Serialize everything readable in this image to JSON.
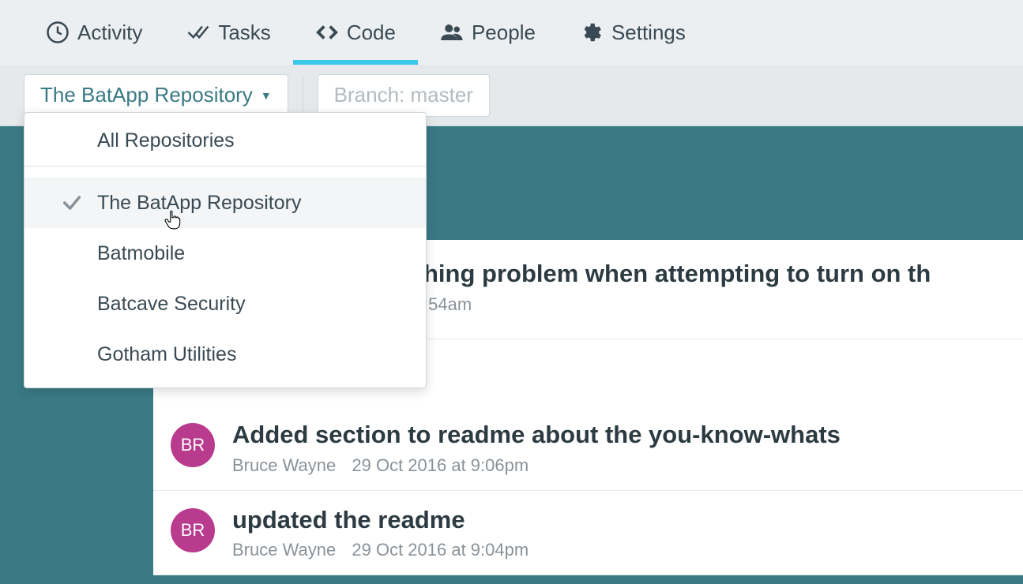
{
  "nav": {
    "activity": "Activity",
    "tasks": "Tasks",
    "code": "Code",
    "people": "People",
    "settings": "Settings"
  },
  "filters": {
    "repo_label": "The BatApp Repository",
    "branch_label": "Branch: master"
  },
  "dropdown": {
    "all": "All Repositories",
    "items": [
      "The BatApp Repository",
      "Batmobile",
      "Batcave Security",
      "Gotham Utilities"
    ]
  },
  "commits": [
    {
      "initials": "",
      "title_partial": "hing problem when attempting to turn on th",
      "meta_partial": ":54am"
    },
    {
      "initials": "BR",
      "title": "Added section to readme about the you-know-whats",
      "author": "Bruce Wayne",
      "timestamp": "29 Oct 2016 at 9:06pm"
    },
    {
      "initials": "BR",
      "title": "updated the readme",
      "author": "Bruce Wayne",
      "timestamp": "29 Oct 2016 at 9:04pm"
    }
  ]
}
